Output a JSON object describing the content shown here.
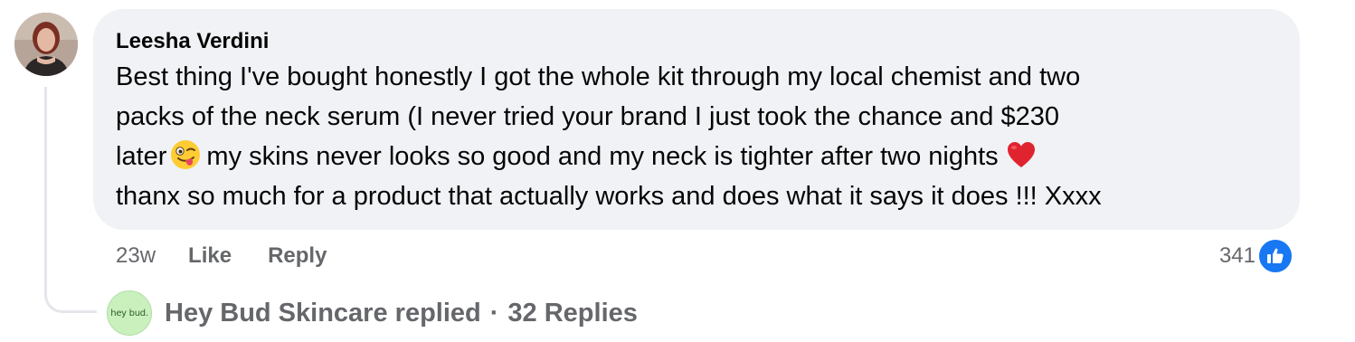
{
  "comment": {
    "author": "Leesha Verdini",
    "text_lines": [
      "Best thing I've bought honestly I got the whole kit through my local chemist and two",
      "packs of the neck serum (I never tried your brand I just took the chance and $230",
      "my skins never looks so good and my neck is tighter after two nights",
      "thanx so much for a product that actually works and does what it says it does !!! Xxxx"
    ],
    "line3_prefix": "later",
    "emojis": [
      "winking-tongue-emoji",
      "red-heart-emoji"
    ],
    "time": "23w",
    "like_label": "Like",
    "reply_label": "Reply",
    "reaction_count": "341",
    "reaction_icon": "thumbs-up-icon"
  },
  "replies": {
    "brand_avatar_text": "hey bud.",
    "summary": "Hey Bud Skincare replied",
    "separator": "·",
    "count_label": "32 Replies"
  },
  "colors": {
    "bubble": "#f0f2f5",
    "secondary_text": "#65676b",
    "like_blue": "#1877f2",
    "brand_green": "#c9f0bd"
  }
}
